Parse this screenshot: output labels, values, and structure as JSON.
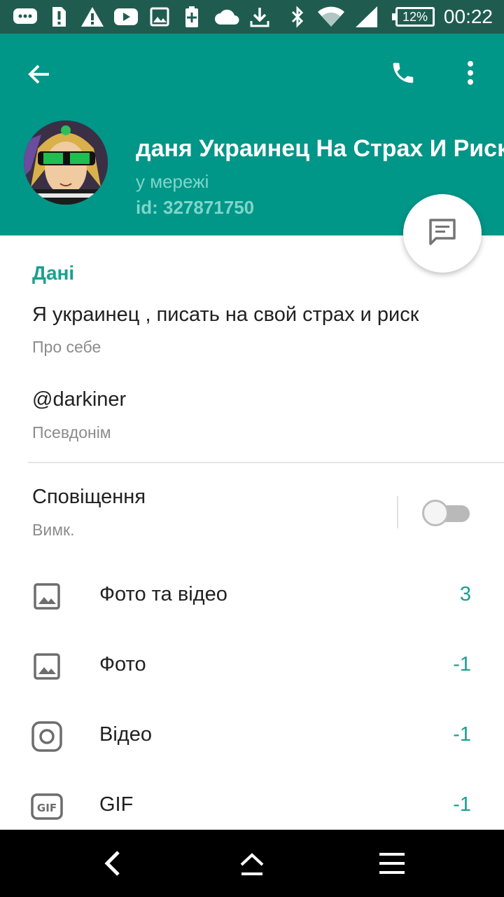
{
  "status_bar": {
    "battery": "12%",
    "time": "00:22",
    "icons": [
      "chat-notification-icon",
      "sim-alert-icon",
      "warning-icon",
      "youtube-icon",
      "image-icon",
      "battery-saver-icon",
      "cloud-icon",
      "download-icon",
      "bluetooth-icon",
      "wifi-icon",
      "signal-icon"
    ]
  },
  "header": {
    "name": "даня Украинец На Страх И Риск",
    "online": "у мережі",
    "id": "id: 327871750"
  },
  "info": {
    "section_title": "Дані",
    "bio": "Я украинец , писать на свой страх и риск",
    "bio_label": "Про себе",
    "username": "@darkiner",
    "username_label": "Псевдонім"
  },
  "notifications": {
    "title": "Сповіщення",
    "state": "Вимк."
  },
  "media": [
    {
      "label": "Фото та відео",
      "count": "3",
      "icon": "photo-video-icon"
    },
    {
      "label": "Фото",
      "count": "-1",
      "icon": "photo-icon"
    },
    {
      "label": "Відео",
      "count": "-1",
      "icon": "video-icon"
    },
    {
      "label": "GIF",
      "count": "-1",
      "icon": "gif-icon"
    }
  ],
  "colors": {
    "header": "#009688",
    "status_bar": "#1f5c4f",
    "accent": "#1aa08f"
  }
}
